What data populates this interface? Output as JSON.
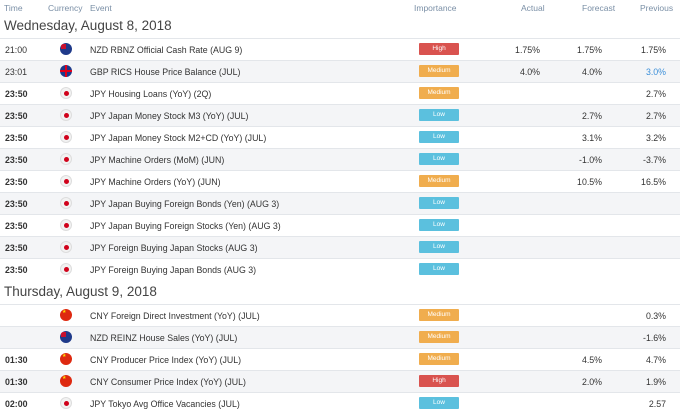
{
  "headers": {
    "time": "Time",
    "currency": "Currency",
    "event": "Event",
    "importance": "Importance",
    "actual": "Actual",
    "forecast": "Forecast",
    "previous": "Previous"
  },
  "colors": {
    "high": "#d9534f",
    "medium": "#f0ad4e",
    "low": "#5bc0de",
    "link_blue": "#3b8fd9"
  },
  "sections": [
    {
      "date": "Wednesday, August 8, 2018",
      "rows": [
        {
          "time": "21:00",
          "flag": "nz-flag-icon",
          "event": "NZD RBNZ Official Cash Rate (AUG 9)",
          "importance": "High",
          "actual": "1.75%",
          "forecast": "1.75%",
          "previous": "1.75%"
        },
        {
          "time": "23:01",
          "flag": "gb-flag-icon",
          "event": "GBP RICS House Price Balance (JUL)",
          "importance": "Medium",
          "actual": "4.0%",
          "forecast": "4.0%",
          "previous": "3.0%"
        },
        {
          "time": "23:50",
          "flag": "jp-flag-icon",
          "event": "JPY Housing Loans (YoY) (2Q)",
          "importance": "Medium",
          "actual": "",
          "forecast": "",
          "previous": "2.7%"
        },
        {
          "time": "23:50",
          "flag": "jp-flag-icon",
          "event": "JPY Japan Money Stock M3 (YoY) (JUL)",
          "importance": "Low",
          "actual": "",
          "forecast": "2.7%",
          "previous": "2.7%"
        },
        {
          "time": "23:50",
          "flag": "jp-flag-icon",
          "event": "JPY Japan Money Stock M2+CD (YoY) (JUL)",
          "importance": "Low",
          "actual": "",
          "forecast": "3.1%",
          "previous": "3.2%"
        },
        {
          "time": "23:50",
          "flag": "jp-flag-icon",
          "event": "JPY Machine Orders (MoM) (JUN)",
          "importance": "Low",
          "actual": "",
          "forecast": "-1.0%",
          "previous": "-3.7%"
        },
        {
          "time": "23:50",
          "flag": "jp-flag-icon",
          "event": "JPY Machine Orders (YoY) (JUN)",
          "importance": "Medium",
          "actual": "",
          "forecast": "10.5%",
          "previous": "16.5%"
        },
        {
          "time": "23:50",
          "flag": "jp-flag-icon",
          "event": "JPY Japan Buying Foreign Bonds (Yen) (AUG 3)",
          "importance": "Low",
          "actual": "",
          "forecast": "",
          "previous": ""
        },
        {
          "time": "23:50",
          "flag": "jp-flag-icon",
          "event": "JPY Japan Buying Foreign Stocks (Yen) (AUG 3)",
          "importance": "Low",
          "actual": "",
          "forecast": "",
          "previous": ""
        },
        {
          "time": "23:50",
          "flag": "jp-flag-icon",
          "event": "JPY Foreign Buying Japan Stocks (AUG 3)",
          "importance": "Low",
          "actual": "",
          "forecast": "",
          "previous": ""
        },
        {
          "time": "23:50",
          "flag": "jp-flag-icon",
          "event": "JPY Foreign Buying Japan Bonds (AUG 3)",
          "importance": "Low",
          "actual": "",
          "forecast": "",
          "previous": ""
        }
      ]
    },
    {
      "date": "Thursday, August 9, 2018",
      "rows": [
        {
          "time": "",
          "flag": "cn-flag-icon",
          "event": "CNY Foreign Direct Investment (YoY) (JUL)",
          "importance": "Medium",
          "actual": "",
          "forecast": "",
          "previous": "0.3%"
        },
        {
          "time": "",
          "flag": "nz-flag-icon",
          "event": "NZD REINZ House Sales (YoY) (JUL)",
          "importance": "Medium",
          "actual": "",
          "forecast": "",
          "previous": "-1.6%"
        },
        {
          "time": "01:30",
          "flag": "cn-flag-icon",
          "event": "CNY Producer Price Index (YoY) (JUL)",
          "importance": "Medium",
          "actual": "",
          "forecast": "4.5%",
          "previous": "4.7%"
        },
        {
          "time": "01:30",
          "flag": "cn-flag-icon",
          "event": "CNY Consumer Price Index (YoY) (JUL)",
          "importance": "High",
          "actual": "",
          "forecast": "2.0%",
          "previous": "1.9%"
        },
        {
          "time": "02:00",
          "flag": "jp-flag-icon",
          "event": "JPY Tokyo Avg Office Vacancies (JUL)",
          "importance": "Low",
          "actual": "",
          "forecast": "",
          "previous": "2.57"
        }
      ]
    }
  ]
}
